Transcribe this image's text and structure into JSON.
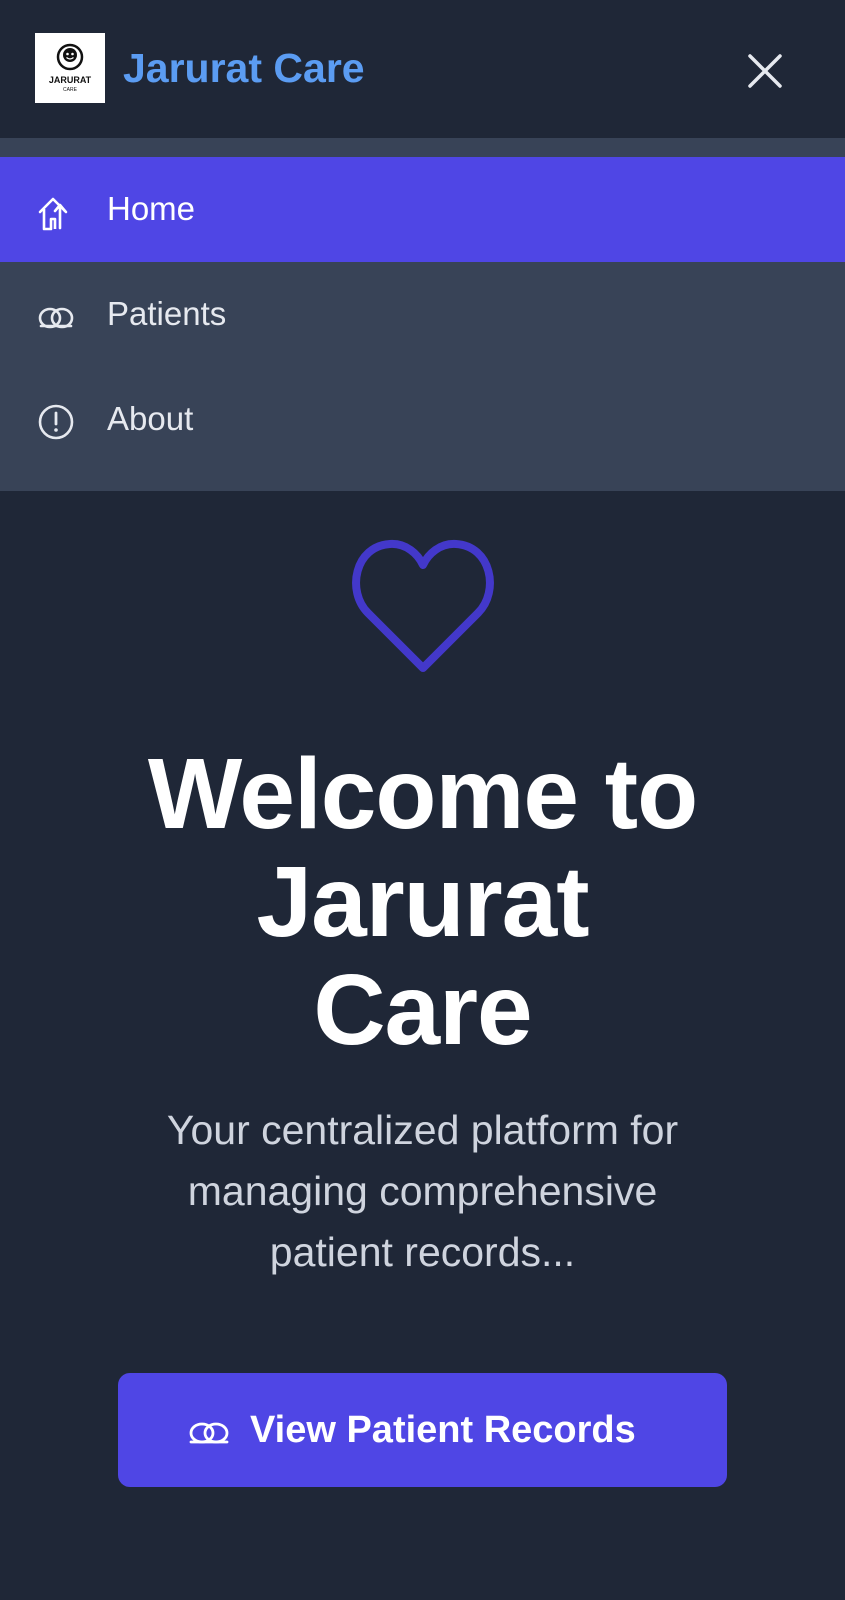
{
  "header": {
    "logo": {
      "text_top": "JARURAT",
      "text_bottom": "CARE"
    },
    "brand_name": "Jarurat Care",
    "close_icon": "close-icon"
  },
  "menu": {
    "items": [
      {
        "label": "Home",
        "icon": "home-icon",
        "active": true
      },
      {
        "label": "Patients",
        "icon": "patients-icon",
        "active": false
      },
      {
        "label": "About",
        "icon": "info-icon",
        "active": false
      }
    ]
  },
  "hero": {
    "icon": "heart-icon",
    "title_lines": [
      "Welcome to",
      "Jarurat",
      "Care"
    ],
    "subtitle_lines": [
      "Your centralized platform for",
      "managing comprehensive",
      "patient records..."
    ]
  },
  "cta": {
    "label": "View Patient Records",
    "icon": "patients-icon"
  },
  "colors": {
    "background": "#1f2737",
    "menu_background": "#384357",
    "accent": "#4f46e5",
    "brand_text": "#5b9cf2",
    "heart": "#4338ca"
  }
}
